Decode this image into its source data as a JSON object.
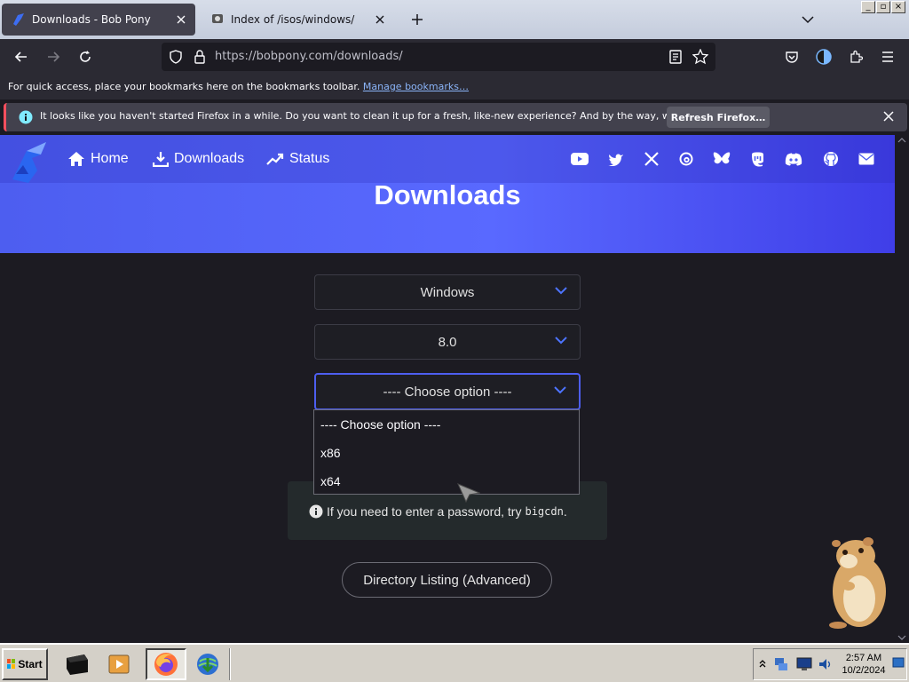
{
  "tabs": [
    {
      "title": "Downloads - Bob Pony",
      "active": true
    },
    {
      "title": "Index of /isos/windows/",
      "active": false
    }
  ],
  "urlbar": {
    "url": "https://bobpony.com/downloads/"
  },
  "bookmarks": {
    "text": "For quick access, place your bookmarks here on the bookmarks toolbar.",
    "link": "Manage bookmarks…"
  },
  "notification": {
    "message": "It looks like you haven't started Firefox in a while. Do you want to clean it up for a fresh, like-new experience? And by the way, welcome back!",
    "button": "Refresh Firefox…"
  },
  "site": {
    "nav": [
      {
        "label": "Home",
        "icon": "home-icon"
      },
      {
        "label": "Downloads",
        "icon": "download-icon"
      },
      {
        "label": "Status",
        "icon": "trending-up-icon"
      }
    ],
    "social_icons": [
      "youtube-icon",
      "twitter-icon",
      "x-icon",
      "threads-icon",
      "bluesky-icon",
      "mastodon-icon",
      "discord-icon",
      "github-icon",
      "email-icon"
    ],
    "title": "Downloads"
  },
  "form": {
    "os_select": "Windows",
    "version_select": "8.0",
    "arch_select": "---- Choose option ----",
    "options": [
      "---- Choose option ----",
      "x86",
      "x64"
    ]
  },
  "info": {
    "text": "If you need to enter a password, try",
    "code": "bigcdn",
    "suffix": "."
  },
  "directory_button": "Directory Listing (Advanced)",
  "taskbar": {
    "start": "Start",
    "time": "2:57 AM",
    "date": "10/2/2024"
  },
  "colors": {
    "accent": "#4d5ef0",
    "hero_start": "#4d5ef0",
    "hero_end": "#3f3ee8"
  }
}
